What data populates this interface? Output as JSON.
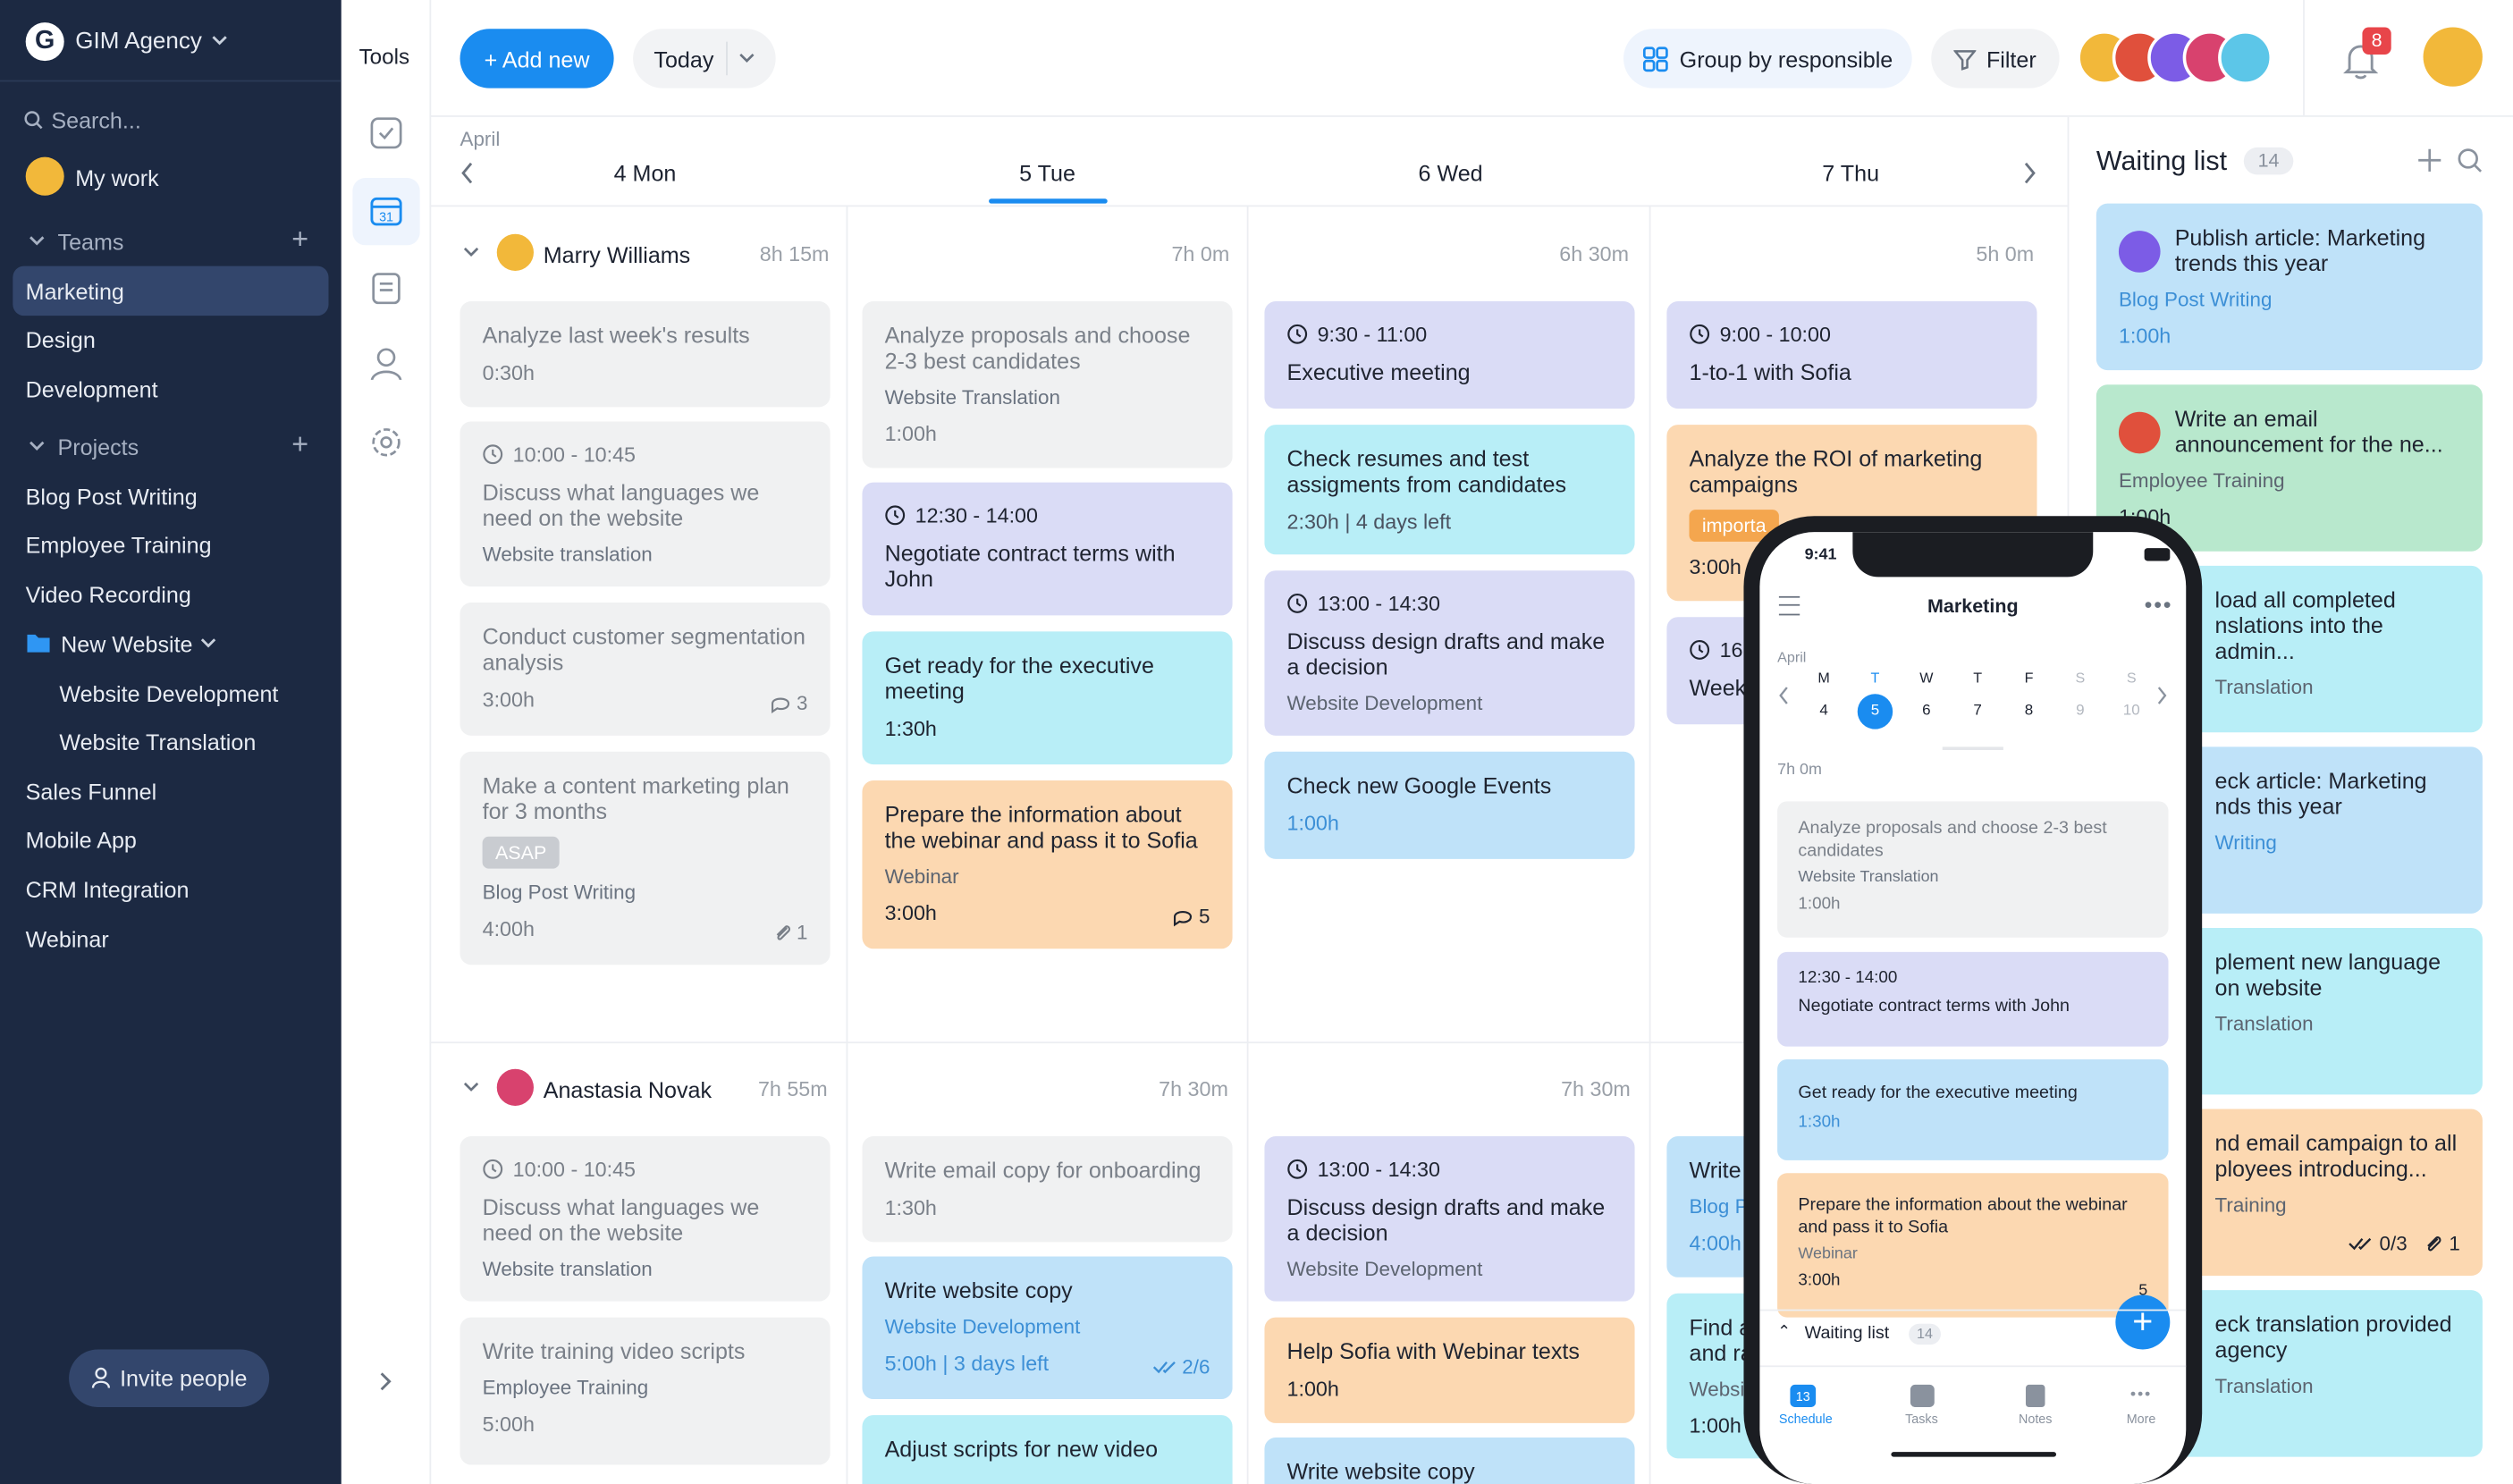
{
  "workspace": {
    "name": "GIM Agency"
  },
  "sidebar": {
    "search_placeholder": "Search...",
    "my_work": "My work",
    "teams_label": "Teams",
    "teams": [
      "Marketing",
      "Design",
      "Development"
    ],
    "projects_label": "Projects",
    "projects": [
      "Blog Post Writing",
      "Employee Training",
      "Video Recording"
    ],
    "folder": {
      "name": "New Website",
      "children": [
        "Website Development",
        "Website Translation"
      ]
    },
    "more_projects": [
      "Sales Funnel",
      "Mobile App",
      "CRM Integration",
      "Webinar"
    ],
    "invite": "Invite people"
  },
  "tools": {
    "label": "Tools",
    "calendar_day": "31"
  },
  "header": {
    "add_new": "+ Add new",
    "today": "Today",
    "group_by": "Group by responsible",
    "filter": "Filter",
    "notifications": "8"
  },
  "calendar": {
    "month": "April",
    "days": [
      "4 Mon",
      "5 Tue",
      "6 Wed",
      "7 Thu"
    ],
    "people": [
      {
        "name": "Marry Williams",
        "hours": [
          "8h 15m",
          "7h 0m",
          "6h 30m",
          "5h 0m"
        ]
      },
      {
        "name": "Anastasia Novak",
        "hours": [
          "7h 55m",
          "7h 30m",
          "7h 30m",
          ""
        ]
      }
    ]
  },
  "cards": {
    "a1": {
      "title": "Analyze last week's results",
      "dur": "0:30h"
    },
    "a2": {
      "time": "10:00 - 10:45",
      "title": "Discuss what languages we need on the website",
      "sub": "Website translation"
    },
    "a3": {
      "title": "Conduct customer segmentation analysis",
      "dur": "3:00h",
      "comments": "3"
    },
    "a4": {
      "title": "Make a content marketing plan for 3 months",
      "badge": "ASAP",
      "sub": "Blog Post Writing",
      "dur": "4:00h",
      "attach": "1"
    },
    "b1": {
      "title": "Analyze proposals and choose 2-3 best candidates",
      "sub": "Website Translation",
      "dur": "1:00h"
    },
    "b2": {
      "time": "12:30 - 14:00",
      "title": "Negotiate contract terms with John"
    },
    "b3": {
      "title": "Get ready for the executive meeting",
      "dur": "1:30h"
    },
    "b4": {
      "title": "Prepare the information about the webinar and pass it to Sofia",
      "sub": "Webinar",
      "dur": "3:00h",
      "comments": "5"
    },
    "c1": {
      "time": "9:30 - 11:00",
      "title": "Executive meeting"
    },
    "c2": {
      "title": "Check resumes and test assigments from candidates",
      "dur": "2:30h | 4 days left"
    },
    "c3": {
      "time": "13:00 - 14:30",
      "title": "Discuss design drafts and make a decision",
      "sub": "Website Development"
    },
    "c4": {
      "title": "Check new Google Events",
      "dur": "1:00h"
    },
    "d1": {
      "time": "9:00 - 10:00",
      "title": "1-to-1 with Sofia"
    },
    "d2": {
      "title": "Analyze the ROI of marketing campaigns",
      "badge": "importa",
      "dur": "3:00h"
    },
    "d3": {
      "time": "16",
      "title": "Week"
    },
    "e1": {
      "time": "10:00 - 10:45",
      "title": "Discuss what languages we need on the website",
      "sub": "Website translation"
    },
    "e2": {
      "title": "Write training video scripts",
      "sub": "Employee Training",
      "dur": "5:00h"
    },
    "f1": {
      "title": "Write email copy for onboarding",
      "dur": "1:30h"
    },
    "f2": {
      "title": "Write website copy",
      "sub": "Website Development",
      "dur": "5:00h | 3 days left",
      "checks": "2/6"
    },
    "f3": {
      "title": "Adjust scripts for new video"
    },
    "g1": {
      "time": "13:00 - 14:30",
      "title": "Discuss design drafts and make a decision",
      "sub": "Website Development"
    },
    "g2": {
      "title": "Help Sofia with Webinar texts",
      "dur": "1:00h"
    },
    "g3": {
      "title": "Write website copy"
    },
    "h1": {
      "title": "Write",
      "sub": "Blog P",
      "dur": "4:00h"
    },
    "h2": {
      "title": "Find a and ra",
      "sub": "Websi",
      "dur": "1:00h"
    }
  },
  "waiting_list": {
    "title": "Waiting list",
    "count": "14",
    "items": [
      {
        "title": "Publish article: Marketing trends this year",
        "sub": "Blog Post Writing",
        "dur": "1:00h"
      },
      {
        "title": "Write an email announcement for the ne...",
        "sub": "Employee Training",
        "dur": "1:00h"
      },
      {
        "title": "load all completed nslations into the admin...",
        "sub": "Translation"
      },
      {
        "title": "eck article: Marketing nds this year",
        "sub": "Writing"
      },
      {
        "title": "plement new language on website",
        "sub": "Translation"
      },
      {
        "title": "nd email campaign to all ployees introducing...",
        "sub": "Training",
        "checks": "0/3",
        "attach": "1"
      },
      {
        "title": "eck translation provided agency",
        "sub": "Translation"
      }
    ]
  },
  "phone": {
    "time": "9:41",
    "title": "Marketing",
    "month": "April",
    "week_letters": [
      "M",
      "T",
      "W",
      "T",
      "F",
      "S",
      "S"
    ],
    "week_nums": [
      "4",
      "5",
      "6",
      "7",
      "8",
      "9",
      "10"
    ],
    "hours": "7h 0m",
    "cards": [
      {
        "title": "Analyze proposals and choose 2-3 best candidates",
        "sub": "Website Translation",
        "dur": "1:00h"
      },
      {
        "time": "12:30 - 14:00",
        "title": "Negotiate contract terms with John"
      },
      {
        "title": "Get ready for the executive meeting",
        "dur": "1:30h"
      },
      {
        "title": "Prepare the information about the webinar and pass it to Sofia",
        "sub": "Webinar",
        "dur": "3:00h",
        "comments": "5"
      }
    ],
    "waiting": "Waiting list",
    "waiting_count": "14",
    "tabs": [
      "Schedule",
      "Tasks",
      "Notes",
      "More"
    ],
    "tab_day": "13"
  },
  "colors": {
    "sidebar": "#1c2942",
    "accent": "#1a8cf0",
    "notify": "#e8454a"
  }
}
